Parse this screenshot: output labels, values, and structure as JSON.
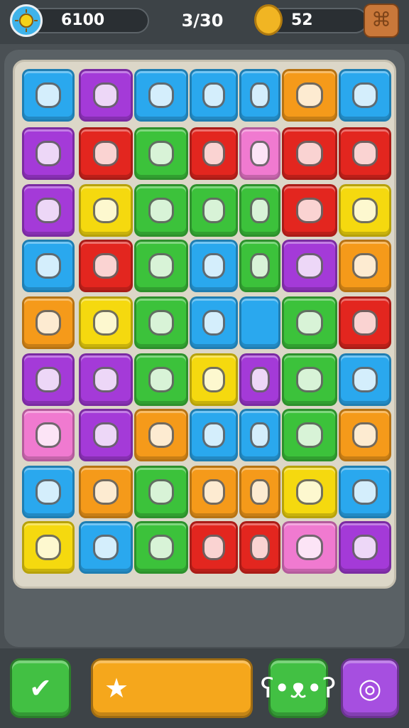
{
  "hud": {
    "score": "6100",
    "moves": "3/30",
    "coins": "52",
    "sun_icon": "sun-icon",
    "coin_icon": "coin-icon",
    "menu_icon": "menu-icon"
  },
  "colors": {
    "blue": "#2aa8ee",
    "purple": "#a43ad8",
    "orange": "#f59a1a",
    "green": "#3cc23b",
    "red": "#e3261f",
    "yellow": "#f5d90f",
    "pink": "#f07ad0"
  },
  "board": {
    "rows": [
      [
        {
          "color": "blue",
          "icon": "juice-can-icon"
        },
        {
          "color": "purple",
          "icon": "notepad-icon"
        },
        {
          "color": "blue",
          "icon": "cat-face-icon"
        },
        {
          "color": "blue",
          "icon": "bear-face-icon"
        },
        {
          "color": "blue",
          "icon": "swirl-icon"
        },
        {
          "color": "orange",
          "icon": "blue-drop-icon"
        },
        {
          "color": "blue",
          "icon": "red-flower-icon"
        }
      ],
      [
        {
          "color": "purple",
          "icon": "robot-face-icon"
        },
        {
          "color": "red",
          "icon": "white-star-icon"
        },
        {
          "color": "green",
          "icon": "purple-bird-icon"
        },
        {
          "color": "red",
          "icon": "gray-blob-icon"
        },
        {
          "color": "pink",
          "icon": "white-envelope-icon"
        },
        {
          "color": "red",
          "icon": "yellow-leaf-icon"
        },
        {
          "color": "red",
          "icon": "stairs-icon"
        }
      ],
      [
        {
          "color": "purple",
          "icon": "brown-box-icon"
        },
        {
          "color": "yellow",
          "icon": "blue-hook-icon"
        },
        {
          "color": "green",
          "icon": "blue-bell-icon"
        },
        {
          "color": "green",
          "icon": "red-heart-icon"
        },
        {
          "color": "green",
          "icon": "red-heart-icon"
        },
        {
          "color": "red",
          "icon": "green-bubble-icon"
        },
        {
          "color": "yellow",
          "icon": "purple-heart-icon"
        }
      ],
      [
        {
          "color": "blue",
          "icon": "yellow-key-icon"
        },
        {
          "color": "red",
          "icon": "blue-gear-icon"
        },
        {
          "color": "green",
          "icon": "phone-icon"
        },
        {
          "color": "blue",
          "icon": "football-icon"
        },
        {
          "color": "green",
          "icon": "palm-tree-icon"
        },
        {
          "color": "purple",
          "icon": "sun-face-icon"
        },
        {
          "color": "orange",
          "icon": "teal-drop-icon"
        }
      ],
      [
        {
          "color": "orange",
          "icon": "pin-icon"
        },
        {
          "color": "yellow",
          "icon": "box-icon"
        },
        {
          "color": "green",
          "icon": "pumpkin-face-icon"
        },
        {
          "color": "blue",
          "icon": "red-fish-icon"
        },
        {
          "color": "blue",
          "icon": ""
        },
        {
          "color": "green",
          "icon": "purple-brush-icon"
        },
        {
          "color": "red",
          "icon": "ring-icon"
        }
      ],
      [
        {
          "color": "purple",
          "icon": "pencil-icon"
        },
        {
          "color": "purple",
          "icon": "white-circle-icon"
        },
        {
          "color": "green",
          "icon": "red-house-icon"
        },
        {
          "color": "yellow",
          "icon": "bear-face-icon"
        },
        {
          "color": "purple",
          "icon": "purple-pen-icon"
        },
        {
          "color": "green",
          "icon": "calculator-icon"
        },
        {
          "color": "blue",
          "icon": "yellow-blob-icon"
        }
      ],
      [
        {
          "color": "pink",
          "icon": "green-leaf-icon"
        },
        {
          "color": "purple",
          "icon": "carrot-card-icon"
        },
        {
          "color": "orange",
          "icon": "blue-bird-icon"
        },
        {
          "color": "blue",
          "icon": "yellow-pencil-icon"
        },
        {
          "color": "blue",
          "icon": "blue-feather-icon"
        },
        {
          "color": "green",
          "icon": "monkey-face-icon"
        },
        {
          "color": "orange",
          "icon": "lion-face-icon"
        }
      ],
      [
        {
          "color": "blue",
          "icon": "cup-face-icon"
        },
        {
          "color": "orange",
          "icon": "white-wing-icon"
        },
        {
          "color": "green",
          "icon": "red-heart-icon"
        },
        {
          "color": "orange",
          "icon": "green-monster-icon"
        },
        {
          "color": "orange",
          "icon": "yellow-bird-icon"
        },
        {
          "color": "yellow",
          "icon": "pink-swirl-icon"
        },
        {
          "color": "blue",
          "icon": "white-face-icon"
        }
      ],
      [
        {
          "color": "yellow",
          "icon": "red-heart-icon"
        },
        {
          "color": "blue",
          "icon": "gray-cloud-icon"
        },
        {
          "color": "green",
          "icon": "blue-gem-icon"
        },
        {
          "color": "red",
          "icon": "yellow-key-icon"
        },
        {
          "color": "red",
          "icon": "blue-jar-icon"
        },
        {
          "color": "pink",
          "icon": "green-balloon-icon"
        },
        {
          "color": "purple",
          "icon": "spiral-icon"
        }
      ]
    ]
  },
  "bottom": {
    "left_icon": "checkmark-note-icon",
    "center_icon": "star-icon",
    "right1_icon": "bear-icon",
    "right2_icon": "compass-icon"
  }
}
